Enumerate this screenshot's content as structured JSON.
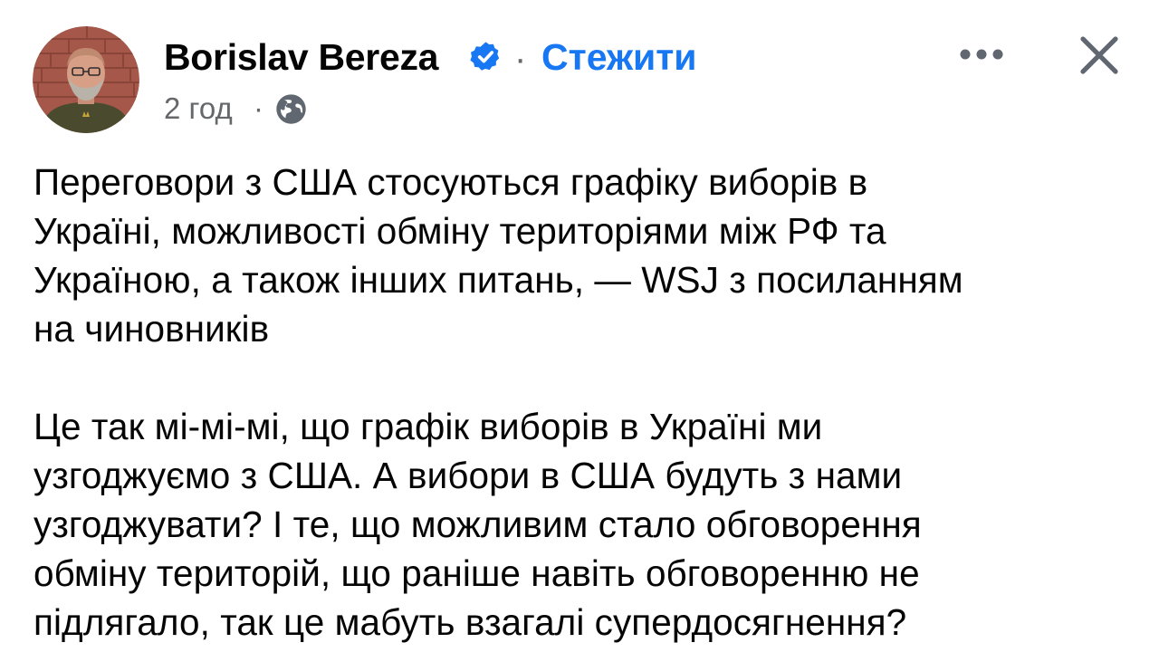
{
  "post": {
    "author": {
      "name": "Borislav Bereza",
      "verified": true,
      "avatar_icon": "profile-photo"
    },
    "separator": "·",
    "follow_label": "Стежити",
    "timestamp": "2 год",
    "meta_separator": "·",
    "audience_icon": "globe-icon",
    "text": {
      "paragraph_1": [
        "Переговори з США стосуються графіку виборів в",
        "Україні, можливості обміну територіями між РФ та",
        "Україною, а також інших питань, — WSJ з посиланням",
        "на чиновників"
      ],
      "paragraph_2": [
        "Це так мі-мі-мі, що графік виборів в Україні ми",
        "узгоджуємо з США. А вибори в США будуть з нами",
        "узгоджувати? І те, що можливим стало обговорення",
        "обміну територій, що раніше навіть обговоренню не",
        "підлягало, так це мабуть взагалі супердосягнення?"
      ]
    }
  },
  "colors": {
    "name": "#050505",
    "meta": "#65676b",
    "link": "#1877f2",
    "verified_badge": "#1877f2",
    "icon": "#606770"
  }
}
